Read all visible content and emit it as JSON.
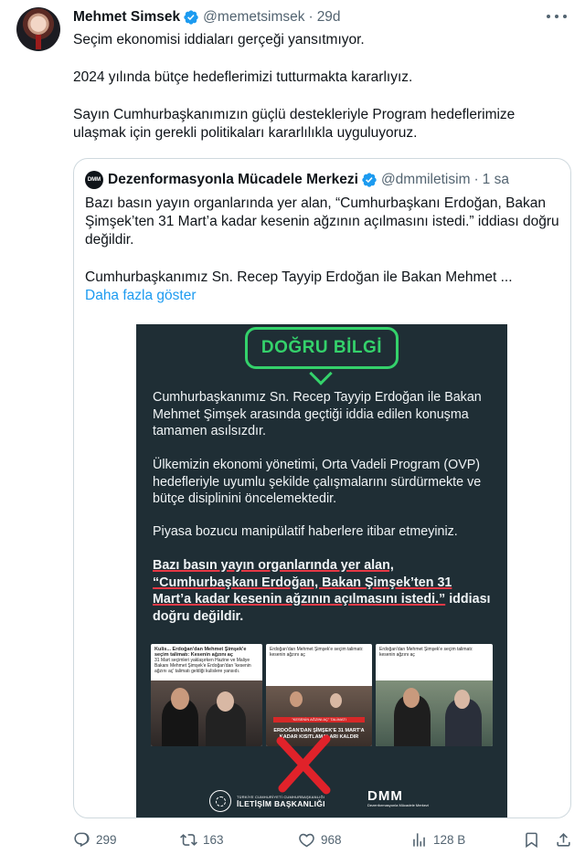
{
  "tweet": {
    "author_name": "Mehmet Simsek",
    "handle": "@memetsimsek",
    "separator": "·",
    "time": "29d",
    "paragraphs": [
      "Seçim ekonomisi iddiaları gerçeği yansıtmıyor.",
      "2024 yılında bütçe hedeflerimizi tutturmakta kararlıyız.",
      "Sayın Cumhurbaşkanımızın güçlü destekleriyle Program hedeflerimize ulaşmak için gerekli politikaları kararlılıkla uyguluyoruz."
    ]
  },
  "quote": {
    "avatar_text": "DMM",
    "author_name": "Dezenformasyonla Mücadele Merkezi",
    "handle": "@dmmiletisim",
    "separator": "·",
    "time": "1 sa",
    "paragraphs": [
      "Bazı basın yayın organlarında yer alan, “Cumhurbaşkanı Erdoğan, Bakan Şimşek’ten 31 Mart’a kadar kesenin ağzının açılmasını istedi.” iddiası doğru değildir.",
      "Cumhurbaşkanımız Sn. Recep Tayyip Erdoğan ile Bakan Mehmet ..."
    ],
    "show_more": "Daha fazla göster"
  },
  "infographic": {
    "badge": "DOĞRU BİLGİ",
    "p1": "Cumhurbaşkanımız Sn. Recep Tayyip Erdoğan ile Bakan Mehmet Şimşek arasında geçtiği iddia edilen konuşma tamamen asılsızdır.",
    "p2": "Ülkemizin ekonomi yönetimi, Orta Vadeli Program (OVP) hedefleriyle uyumlu şekilde çalışmalarını sürdürmekte ve bütçe disiplinini öncelemektedir.",
    "p3": "Piyasa bozucu manipülatif haberlere itibar etmeyiniz.",
    "p4_underlined": "Bazı basın yayın organlarında yer alan, “Cumhurbaşkanı Erdoğan, Bakan Şimşek’ten 31 Mart’a kadar kesenin ağzının açılmasını istedi.”",
    "p4_rest": "iddiası doğru değildir.",
    "shot1_title": "Kulis... Erdoğan'dan Mehmet Şimşek'e seçim talimatı: Kesenin ağzını aç",
    "shot1_text": "31 Mart seçimleri yaklaşırken Hazine ve Maliye Bakanı Mehmet Şimşek'e Erdoğan'dan 'kesenin ağzını aç' talimatı geldiği kulislere yansıdı.",
    "shot2_text": "Erdoğan'dan Mehmet Şimşek'e seçim talimatı: kesenin ağzını aç",
    "shot2_bar": "\"KESENİN AĞZINI AÇ\" TALİMATI",
    "shot2_headline": "ERDOĞAN'DAN ŞİMŞEK'E 31 MART'A KADAR KISITLAMALARI KALDIR",
    "shot3_text": "Erdoğan'dan Mehmet Şimşek'e seçim talimatı: kesenin ağzını aç",
    "logo1_small": "TÜRKİYE CUMHURİYETİ CUMHURBAŞKANLIĞI",
    "logo1_large": "İLETİŞİM BAŞKANLIĞI",
    "logo2_large": "DMM",
    "logo2_small": "Dezenformasyonla Mücadele Merkezi"
  },
  "actions": {
    "reply_count": "299",
    "retweet_count": "163",
    "like_count": "968",
    "views_count": "128 B"
  },
  "colors": {
    "accent": "#1d9bf0",
    "muted": "#536471",
    "infographic_bg": "#1f2e35",
    "badge_green": "#34d26b",
    "underline_red": "#e63946"
  }
}
